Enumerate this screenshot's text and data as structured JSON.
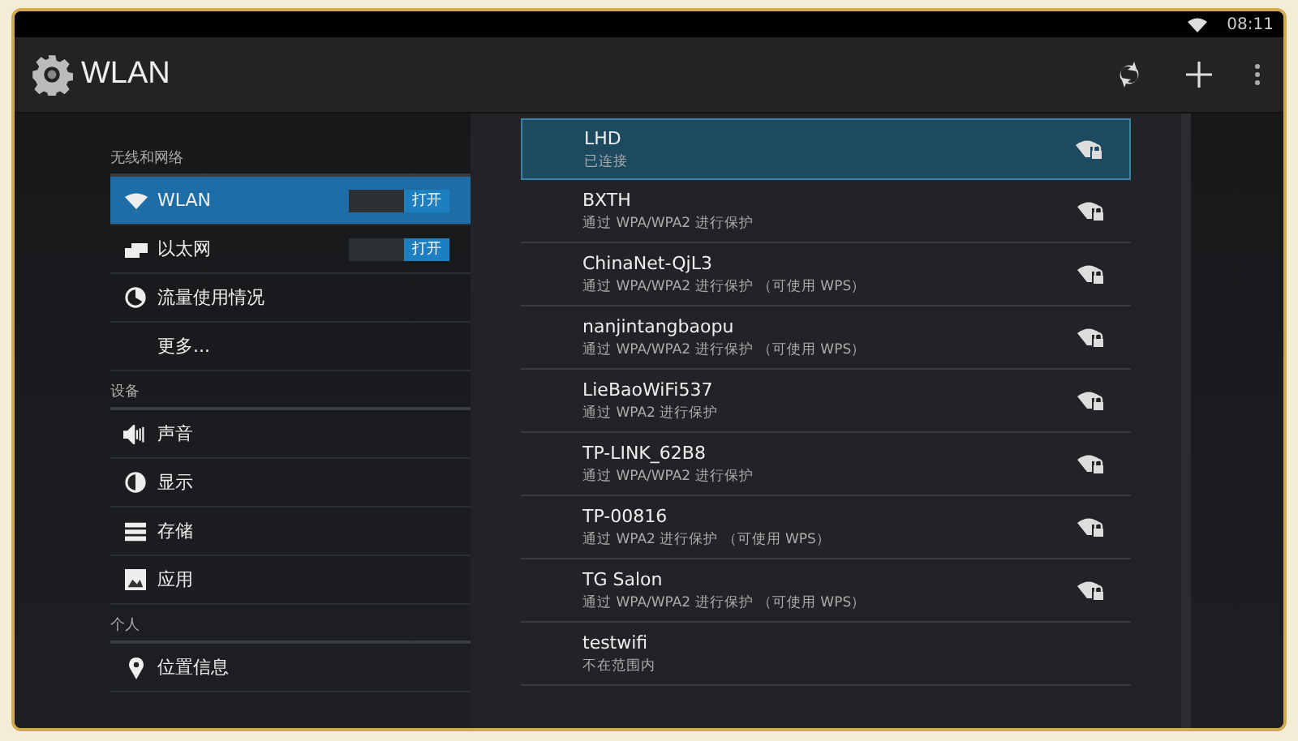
{
  "status_bar": {
    "time": "08:11"
  },
  "action_bar": {
    "title": "WLAN"
  },
  "sidebar": {
    "items": [
      {
        "kind": "header",
        "label": "无线和网络"
      },
      {
        "kind": "switch",
        "label": "WLAN",
        "selected": true,
        "on": true,
        "switch_label": "打开"
      },
      {
        "kind": "switch",
        "label": "以太网",
        "selected": false,
        "on": true,
        "switch_label": "打开"
      },
      {
        "kind": "item",
        "label": "流量使用情况",
        "selected": false
      },
      {
        "kind": "item",
        "label": "更多...",
        "selected": false
      },
      {
        "kind": "header",
        "label": "设备"
      },
      {
        "kind": "item",
        "label": "声音",
        "selected": false
      },
      {
        "kind": "item",
        "label": "显示",
        "selected": false
      },
      {
        "kind": "item",
        "label": "存储",
        "selected": false
      },
      {
        "kind": "item",
        "label": "应用",
        "selected": false
      },
      {
        "kind": "header",
        "label": "个人"
      },
      {
        "kind": "item",
        "label": "位置信息",
        "selected": false
      }
    ]
  },
  "networks": [
    {
      "name": "LHD",
      "status": "已连接",
      "selected": true,
      "in_range": true
    },
    {
      "name": "BXTH",
      "status": "通过 WPA/WPA2 进行保护",
      "selected": false,
      "in_range": true
    },
    {
      "name": "ChinaNet-QjL3",
      "status": "通过 WPA/WPA2 进行保护 （可使用 WPS）",
      "selected": false,
      "in_range": true
    },
    {
      "name": "nanjintangbaopu",
      "status": "通过 WPA/WPA2 进行保护 （可使用 WPS）",
      "selected": false,
      "in_range": true
    },
    {
      "name": "LieBaoWiFi537",
      "status": "通过 WPA2 进行保护",
      "selected": false,
      "in_range": true
    },
    {
      "name": "TP-LINK_62B8",
      "status": "通过 WPA/WPA2 进行保护",
      "selected": false,
      "in_range": true
    },
    {
      "name": "TP-00816",
      "status": "通过 WPA2 进行保护 （可使用 WPS）",
      "selected": false,
      "in_range": true
    },
    {
      "name": "TG Salon",
      "status": "通过 WPA/WPA2 进行保护 （可使用 WPS）",
      "selected": false,
      "in_range": true
    },
    {
      "name": "testwifi",
      "status": "不在范围内",
      "selected": false,
      "in_range": false
    }
  ]
}
